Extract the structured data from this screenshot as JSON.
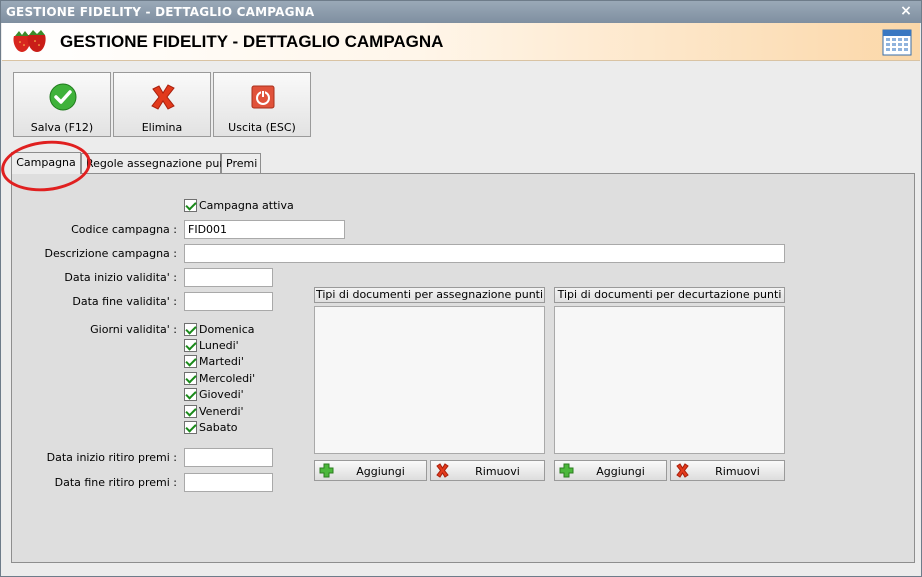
{
  "window": {
    "title": "GESTIONE FIDELITY - DETTAGLIO CAMPAGNA",
    "close_glyph": "×"
  },
  "header": {
    "title": "GESTIONE FIDELITY - DETTAGLIO CAMPAGNA",
    "logo_icon": "strawberries-icon",
    "right_icon": "calendar-icon"
  },
  "toolbar": {
    "save_label": "Salva (F12)",
    "delete_label": "Elimina",
    "exit_label": "Uscita (ESC)"
  },
  "tabs": [
    {
      "label": "Campagna",
      "active": true
    },
    {
      "label": "Regole assegnazione punti",
      "active": false
    },
    {
      "label": "Premi",
      "active": false
    }
  ],
  "form": {
    "active_label": "Campagna attiva",
    "active_checked": true,
    "code_label": "Codice campagna :",
    "code_value": "FID001",
    "desc_label": "Descrizione campagna :",
    "desc_value": "",
    "start_label": "Data inizio validita' :",
    "start_value": "",
    "end_label": "Data fine validita' :",
    "end_value": "",
    "days_label": "Giorni validita' :",
    "days": [
      "Domenica",
      "Lunedi'",
      "Martedi'",
      "Mercoledi'",
      "Giovedi'",
      "Venerdi'",
      "Sabato"
    ],
    "prize_start_label": "Data inizio ritiro premi :",
    "prize_start_value": "",
    "prize_end_label": "Data fine ritiro premi :",
    "prize_end_value": ""
  },
  "lists": {
    "assign_header": "Tipi di documenti per assegnazione punti",
    "deduct_header": "Tipi di documenti per decurtazione punti",
    "add_label": "Aggiungi",
    "remove_label": "Rimuovi"
  },
  "colors": {
    "highlight_ellipse": "#e02020",
    "check": "#1a8a1a",
    "titlebar": "#8797a8"
  }
}
